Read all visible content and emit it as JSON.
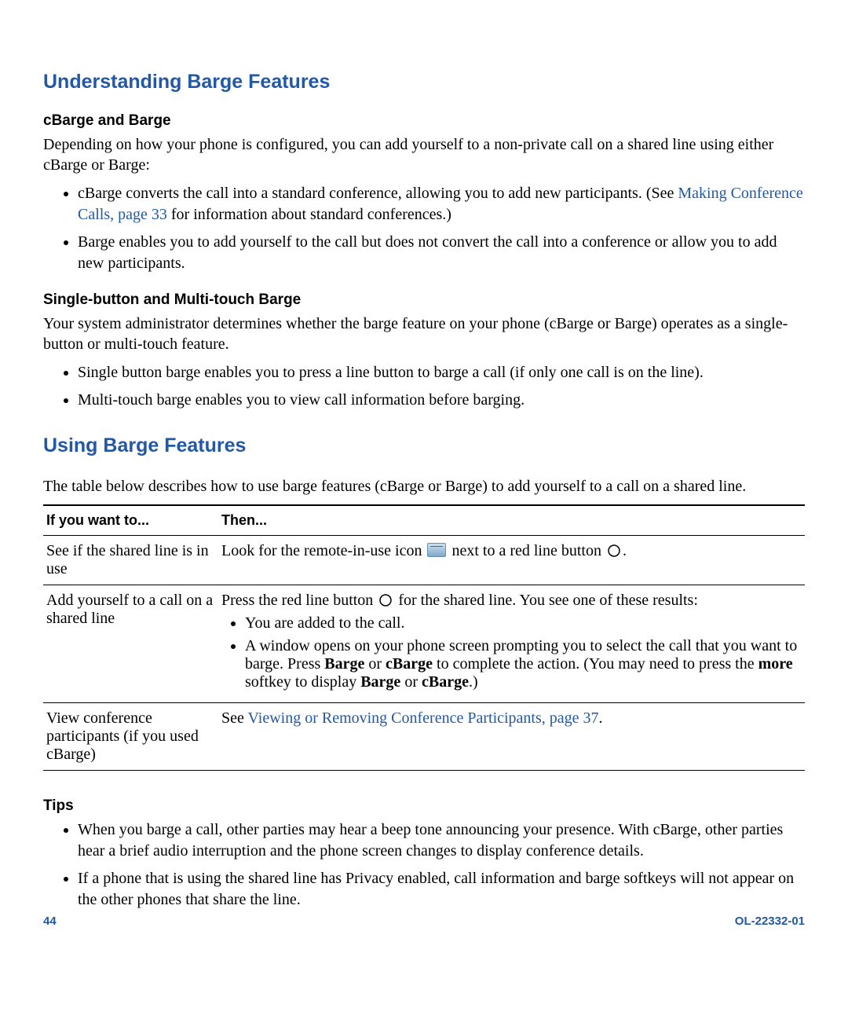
{
  "section1": {
    "title": "Understanding Barge Features",
    "sub1_title": "cBarge and Barge",
    "sub1_para": "Depending on how your phone is configured, you can add yourself to a non-private call on a shared line using either cBarge or Barge:",
    "sub1_b1_pre": "cBarge converts the call into a standard conference, allowing you to add new participants. (See ",
    "sub1_b1_link": "Making Conference Calls, page 33",
    "sub1_b1_post": " for information about standard conferences.)",
    "sub1_b2": "Barge enables you to add yourself to the call but does not convert the call into a conference or allow you to add new participants.",
    "sub2_title": "Single-button and Multi-touch Barge",
    "sub2_para": "Your system administrator determines whether the barge feature on your phone (cBarge or Barge) operates as a single-button or multi-touch feature.",
    "sub2_b1": "Single button barge enables you to press a line button to barge a call (if only one call is on the line).",
    "sub2_b2": "Multi-touch barge enables you to view call information before barging."
  },
  "section2": {
    "title": "Using Barge Features",
    "intro": "The table below describes how to use barge features (cBarge or Barge) to add yourself to a call on a shared line.",
    "th1": "If you want to...",
    "th2": "Then...",
    "r1c1": "See if the shared line is in use",
    "r1c2_pre": "Look for the remote-in-use icon ",
    "r1c2_mid": " next to a red line button ",
    "r1c2_post": ".",
    "r2c1": "Add yourself to a call on a shared line",
    "r2c2_pre": "Press the red line button ",
    "r2c2_mid": " for the shared line. You see one of these results:",
    "r2c2_b1": "You are added to the call.",
    "r2c2_b2_a": "A window opens on your phone screen prompting you to select the call that you want to barge. Press ",
    "r2c2_b2_bold1": "Barge",
    "r2c2_b2_b": " or ",
    "r2c2_b2_bold2": "cBarge",
    "r2c2_b2_c": " to complete the action. (You may need to press the ",
    "r2c2_b2_bold3": "more",
    "r2c2_b2_d": " softkey to display ",
    "r2c2_b2_bold4": "Barge",
    "r2c2_b2_e": " or ",
    "r2c2_b2_bold5": "cBarge",
    "r2c2_b2_f": ".)",
    "r3c1": "View conference participants (if you used cBarge)",
    "r3c2_pre": "See ",
    "r3c2_link": "Viewing or Removing Conference Participants, page 37",
    "r3c2_post": "."
  },
  "tips": {
    "title": "Tips",
    "b1": "When you barge a call, other parties may hear a beep tone announcing your presence. With cBarge, other parties hear a brief audio interruption and the phone screen changes to display conference details.",
    "b2": "If a phone that is using the shared line has Privacy enabled, call information and barge softkeys will not appear on the other phones that share the line."
  },
  "footer": {
    "page": "44",
    "doc": "OL-22332-01"
  }
}
